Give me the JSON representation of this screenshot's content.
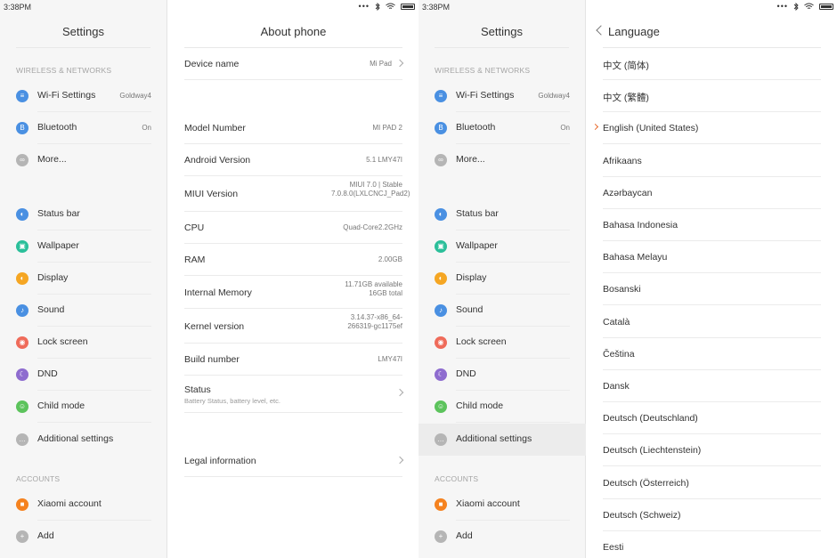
{
  "left_screen": {
    "status": {
      "time": "3:38PM"
    },
    "settings_title": "Settings",
    "sections": {
      "wireless": "WIRELESS & NETWORKS",
      "accounts": "ACCOUNTS"
    },
    "items": [
      {
        "label": "Wi-Fi Settings",
        "value": "Goldway4",
        "icon": "wifi-icon",
        "color": "#4a90e2"
      },
      {
        "label": "Bluetooth",
        "value": "On",
        "icon": "bluetooth-icon",
        "color": "#4a90e2"
      },
      {
        "label": "More...",
        "value": "",
        "icon": "more-icon",
        "color": "#b5b5b5"
      },
      {
        "label": "Status bar",
        "value": "",
        "icon": "status-bar-icon",
        "color": "#4a90e2"
      },
      {
        "label": "Wallpaper",
        "value": "",
        "icon": "wallpaper-icon",
        "color": "#2bbf9a"
      },
      {
        "label": "Display",
        "value": "",
        "icon": "display-icon",
        "color": "#f5a623"
      },
      {
        "label": "Sound",
        "value": "",
        "icon": "sound-icon",
        "color": "#4a90e2"
      },
      {
        "label": "Lock screen",
        "value": "",
        "icon": "lock-icon",
        "color": "#ef6b5a"
      },
      {
        "label": "DND",
        "value": "",
        "icon": "dnd-icon",
        "color": "#8e6ccf"
      },
      {
        "label": "Child mode",
        "value": "",
        "icon": "child-mode-icon",
        "color": "#5cc35c"
      },
      {
        "label": "Additional settings",
        "value": "",
        "icon": "additional-settings-icon",
        "color": "#b5b5b5"
      },
      {
        "label": "Xiaomi account",
        "value": "",
        "icon": "xiaomi-icon",
        "color": "#f5821f"
      },
      {
        "label": "Add",
        "value": "",
        "icon": "add-icon",
        "color": "#b5b5b5"
      }
    ],
    "about": {
      "title": "About phone",
      "device_name": {
        "label": "Device name",
        "value": "Mi Pad"
      },
      "rows": [
        {
          "label": "Model Number",
          "value": "MI PAD 2"
        },
        {
          "label": "Android Version",
          "value": "5.1 LMY47I"
        },
        {
          "label": "MIUI Version",
          "value": "MIUI 7.0 | Stable 7.0.8.0(LXLCNCJ_Pad2)"
        },
        {
          "label": "CPU",
          "value": "Quad-Core2.2GHz"
        },
        {
          "label": "RAM",
          "value": "2.00GB"
        },
        {
          "label": "Internal Memory",
          "value": "11.71GB available 16GB total"
        },
        {
          "label": "Kernel version",
          "value": "3.14.37-x86_64-266319-gc1175ef"
        },
        {
          "label": "Build number",
          "value": "LMY47I"
        }
      ],
      "status": {
        "label": "Status",
        "sub": "Battery Status, battery level, etc."
      },
      "legal": {
        "label": "Legal information"
      }
    }
  },
  "right_screen": {
    "status": {
      "time": "3:38PM"
    },
    "settings_title": "Settings",
    "language": {
      "title": "Language",
      "selected_index": 2,
      "items": [
        "中文 (简体)",
        "中文 (繁體)",
        "English (United States)",
        "Afrikaans",
        "Azərbaycan",
        "Bahasa Indonesia",
        "Bahasa Melayu",
        "Bosanski",
        "Català",
        "Čeština",
        "Dansk",
        "Deutsch (Deutschland)",
        "Deutsch (Liechtenstein)",
        "Deutsch (Österreich)",
        "Deutsch (Schweiz)",
        "Eesti"
      ]
    }
  }
}
